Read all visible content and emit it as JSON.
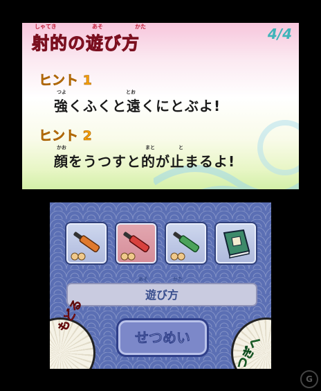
{
  "top": {
    "title": "射的の遊び方",
    "title_ruby": [
      "しゃてき",
      "あそ",
      "かた"
    ],
    "page": "4/4",
    "hint1": {
      "label": "ヒント 1",
      "text": "強くふくと遠くにとぶよ!",
      "ruby": [
        "つよ",
        "とお"
      ]
    },
    "hint2": {
      "label": "ヒント 2",
      "text": "顔をうつすと的が止まるよ!",
      "ruby": [
        "かお",
        "まと",
        "と"
      ]
    }
  },
  "bottom": {
    "items": [
      {
        "icon": "rifle-orange-icon"
      },
      {
        "icon": "rifle-red-icon"
      },
      {
        "icon": "rifle-green-icon"
      },
      {
        "icon": "book-icon"
      }
    ],
    "section_label": "遊び方",
    "section_ruby": [
      "あそ",
      "かた"
    ],
    "explain_button": "せつめい",
    "back_label": "もどる",
    "next_label": "つぎへ"
  },
  "watermark": "G"
}
